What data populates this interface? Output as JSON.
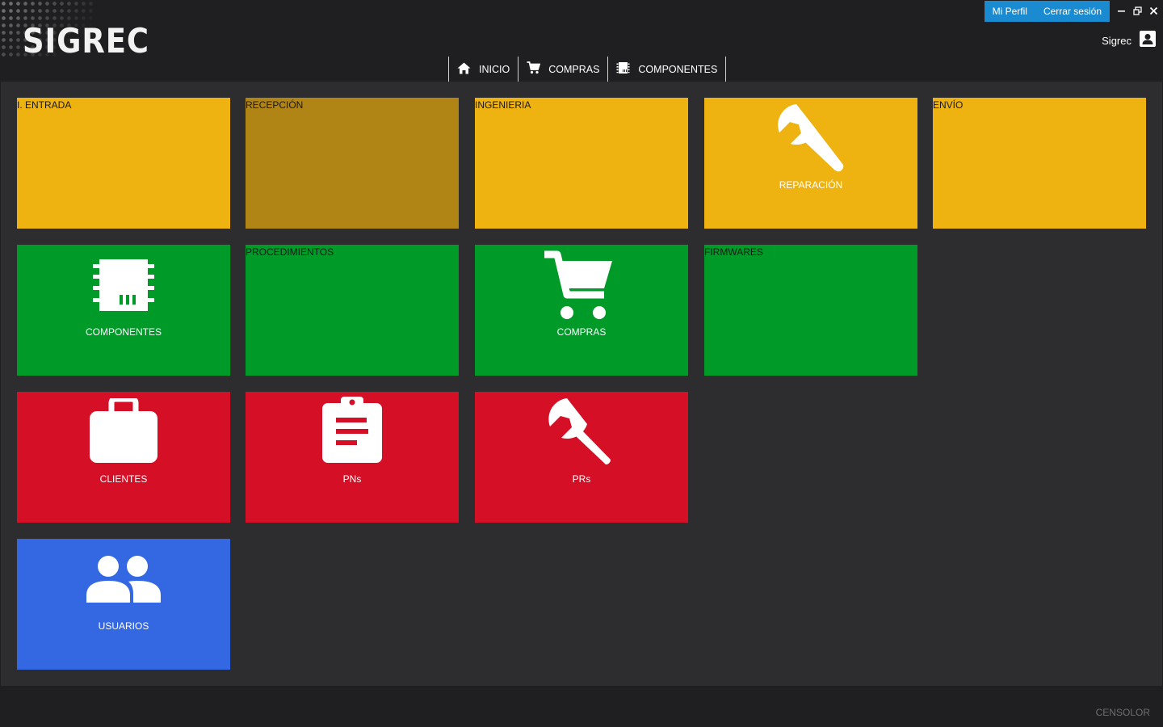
{
  "header": {
    "logo_text": "SIGREC",
    "profile_label": "Mi Perfil",
    "logout_label": "Cerrar sesión",
    "user_name": "Sigrec",
    "window_controls": [
      "minimize-icon",
      "restore-icon",
      "close-icon"
    ]
  },
  "nav": {
    "items": [
      {
        "label": "INICIO",
        "icon": "home-icon"
      },
      {
        "label": "COMPRAS",
        "icon": "cart-icon"
      },
      {
        "label": "COMPONENTES",
        "icon": "chip-icon"
      }
    ]
  },
  "tiles": {
    "entrada": {
      "label": "I. ENTRADA",
      "color": "#eeb211"
    },
    "recepcion": {
      "label": "RECEPCIÓN",
      "color": "#b08415"
    },
    "ingenieria": {
      "label": "INGENIERIA",
      "color": "#eeb211"
    },
    "reparacion": {
      "label": "REPARACIÓN",
      "color": "#eeb211",
      "icon": "wrench-icon"
    },
    "envio": {
      "label": "ENVÍO",
      "color": "#eeb211"
    },
    "componentes": {
      "label": "COMPONENTES",
      "color": "#009a29",
      "icon": "chip-icon"
    },
    "procedimientos": {
      "label": "PROCEDIMIENTOS",
      "color": "#009a29"
    },
    "compras": {
      "label": "COMPRAS",
      "color": "#009a29",
      "icon": "cart-icon"
    },
    "firmwares": {
      "label": "FIRMWARES",
      "color": "#009a29"
    },
    "clientes": {
      "label": "CLIENTES",
      "color": "#d50f25",
      "icon": "briefcase-icon"
    },
    "pns": {
      "label": "PNs",
      "color": "#d50f25",
      "icon": "clipboard-icon"
    },
    "prs": {
      "label": "PRs",
      "color": "#d50f25",
      "icon": "wrench-icon"
    },
    "usuarios": {
      "label": "USUARIOS",
      "color": "#3467e2",
      "icon": "users-icon"
    }
  },
  "footer": {
    "brand": "CENSOLOR"
  }
}
